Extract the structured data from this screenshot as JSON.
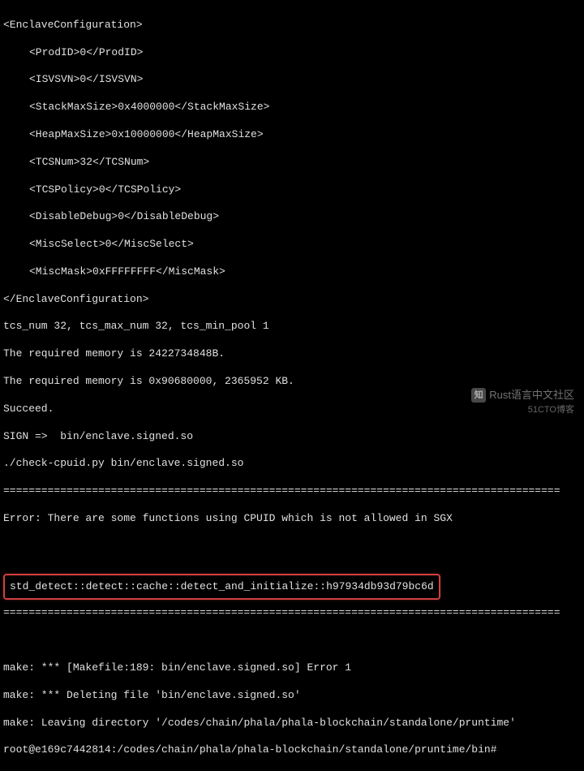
{
  "xml": {
    "open": "<EnclaveConfiguration>",
    "prodid": "<ProdID>0</ProdID>",
    "isvsvn": "<ISVSVN>0</ISVSVN>",
    "stackmax": "<StackMaxSize>0x4000000</StackMaxSize>",
    "heapmax": "<HeapMaxSize>0x10000000</HeapMaxSize>",
    "tcsnum": "<TCSNum>32</TCSNum>",
    "tcspolicy": "<TCSPolicy>0</TCSPolicy>",
    "disabledebug": "<DisableDebug>0</DisableDebug>",
    "miscselect": "<MiscSelect>0</MiscSelect>",
    "miscmask": "<MiscMask>0xFFFFFFFF</MiscMask>",
    "close": "</EnclaveConfiguration>"
  },
  "output": {
    "tcs": "tcs_num 32, tcs_max_num 32, tcs_min_pool 1",
    "mem1": "The required memory is 2422734848B.",
    "mem2": "The required memory is 0x90680000, 2365952 KB.",
    "succeed": "Succeed.",
    "sign": "SIGN =>  bin/enclave.signed.so",
    "check": "./check-cpuid.py bin/enclave.signed.so"
  },
  "divider": "========================================================================================",
  "error": {
    "msg": "Error: There are some functions using CPUID which is not allowed in SGX",
    "highlighted": "std_detect::detect::cache::detect_and_initialize::h97934db93d79bc6d"
  },
  "make": {
    "err1": "make: *** [Makefile:189: bin/enclave.signed.so] Error 1",
    "err2": "make: *** Deleting file 'bin/enclave.signed.so'",
    "leaving": "make: Leaving directory '/codes/chain/phala/phala-blockchain/standalone/pruntime'",
    "prompt": "root@e169c7442814:/codes/chain/phala/phala-blockchain/standalone/pruntime/bin#"
  },
  "watermark": {
    "text": "Rust语言中文社区",
    "sub": "51CTO博客"
  }
}
